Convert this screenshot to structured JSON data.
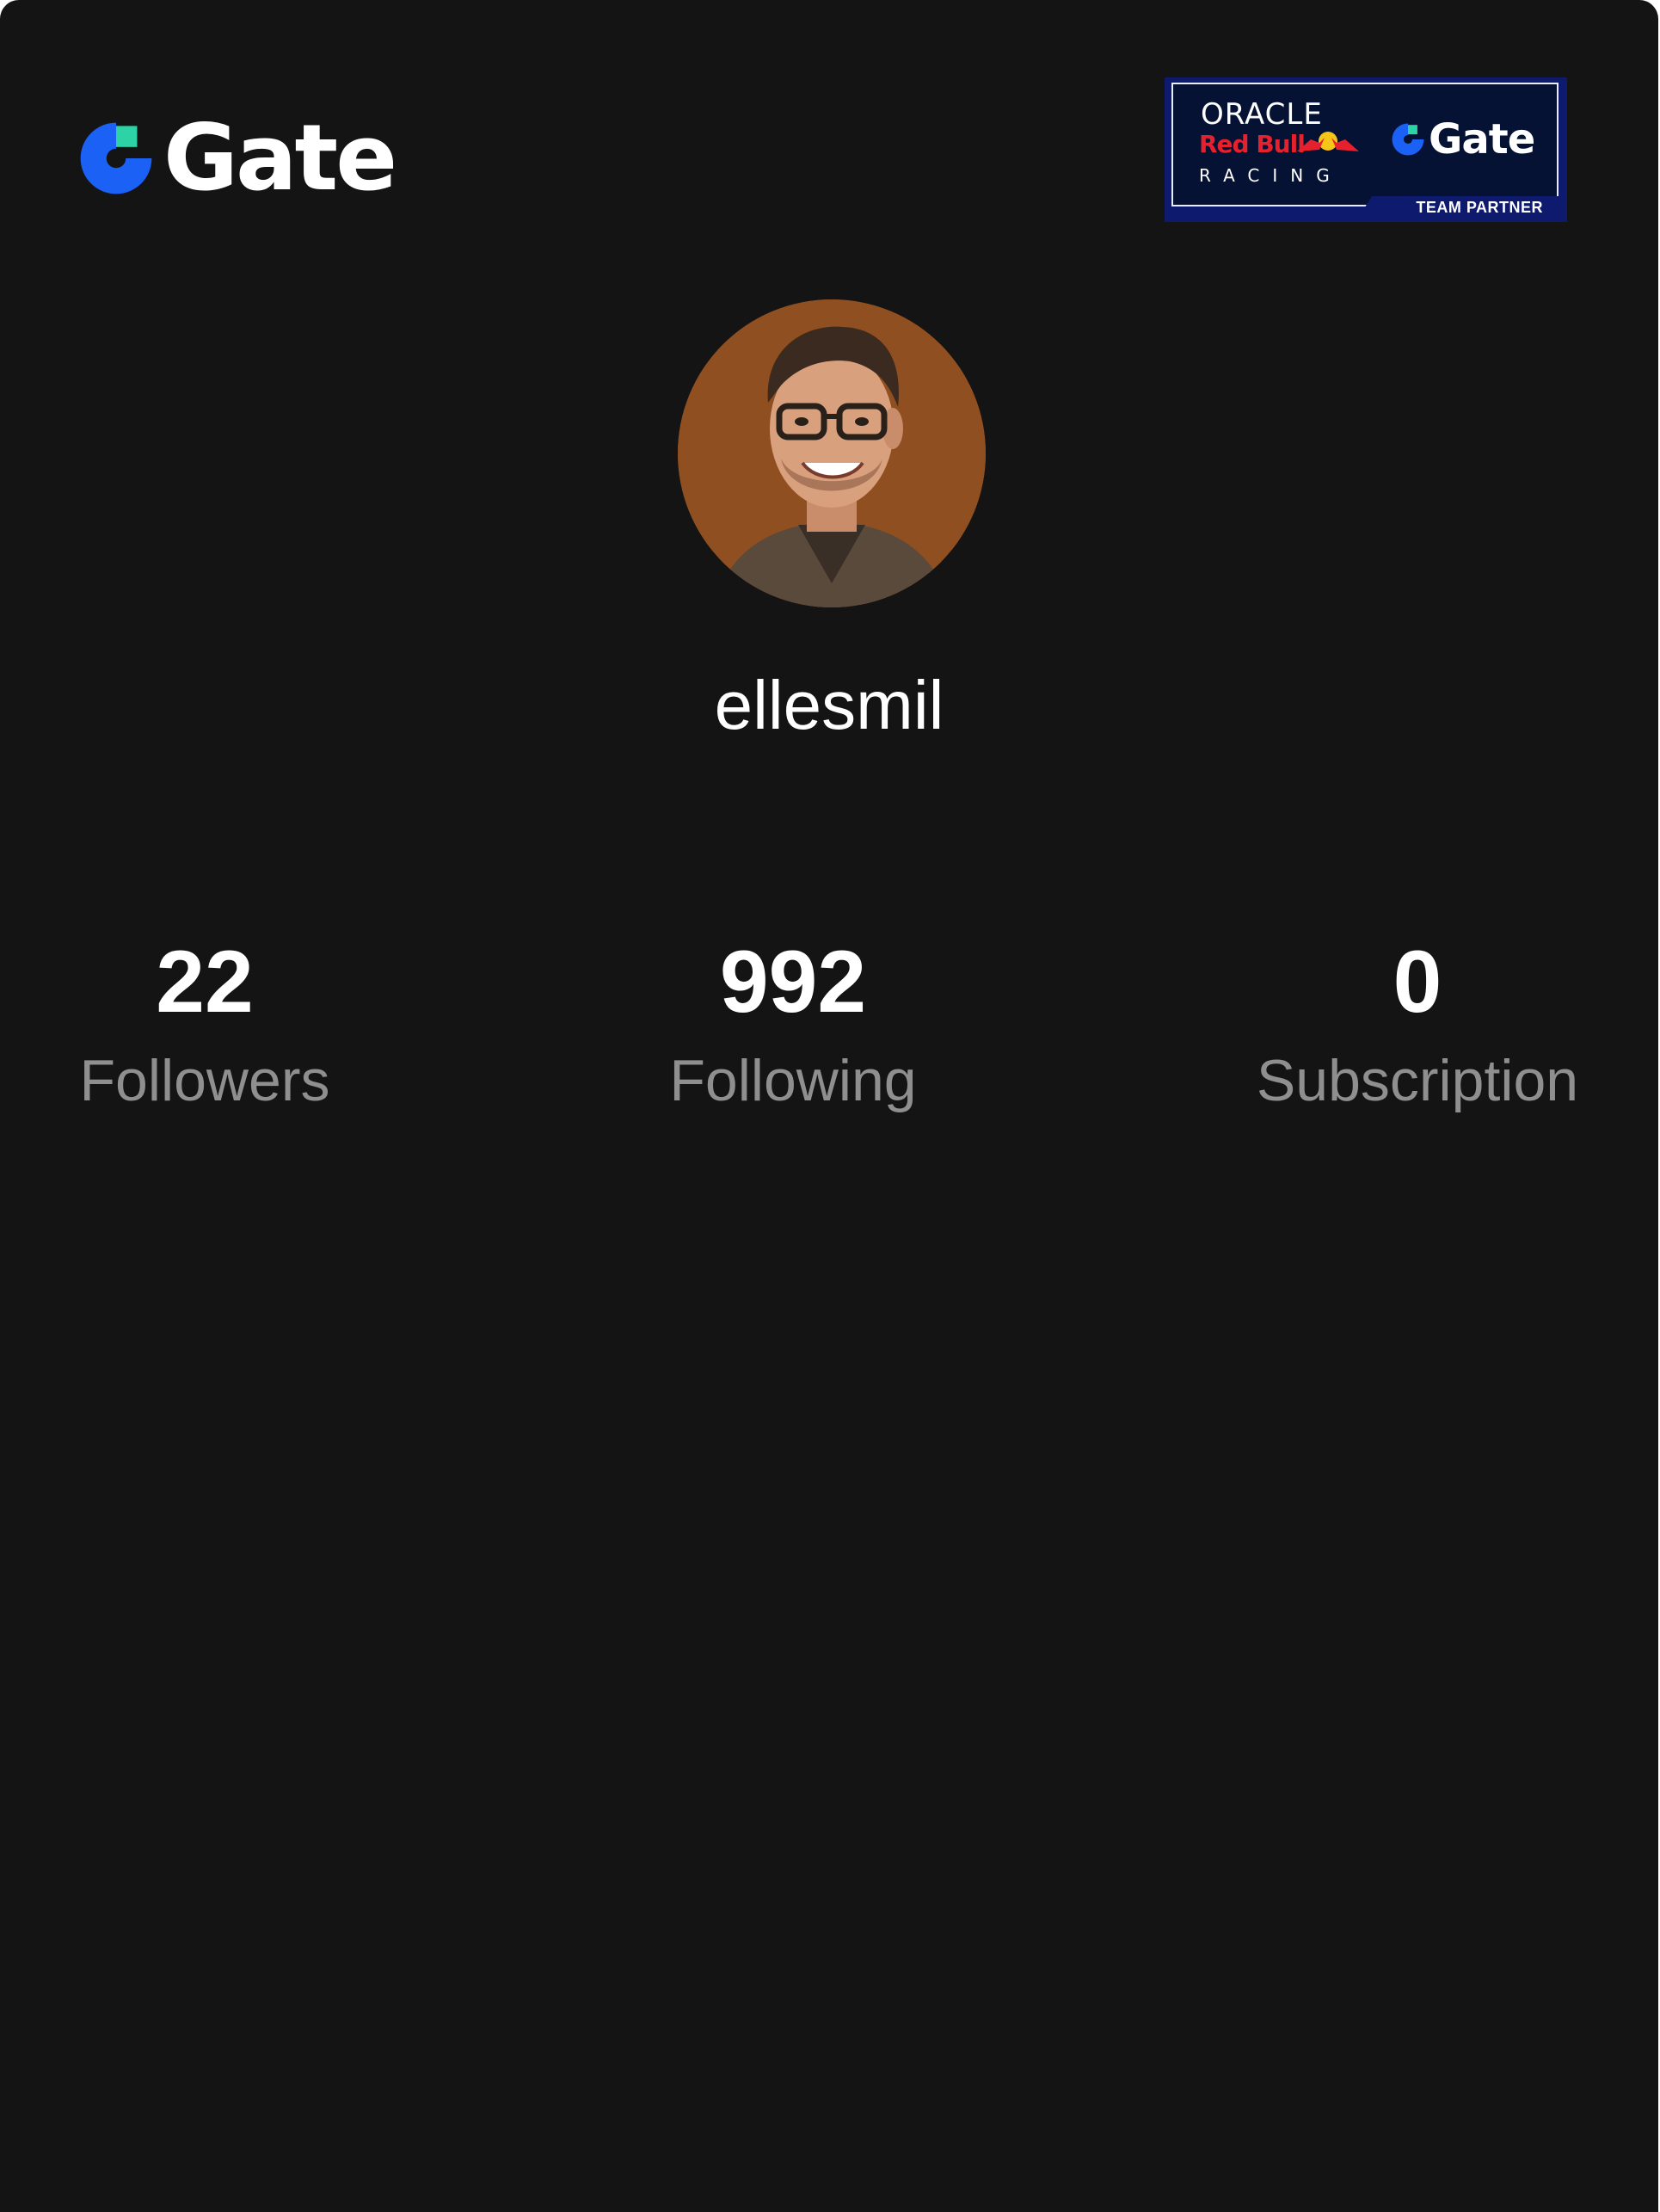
{
  "brand": {
    "logo_word": "Gate",
    "primary_color": "#1b61f5",
    "accent_color": "#2ed3a5"
  },
  "partner_badge": {
    "oracle": "ORACLE",
    "red_bull": "Red Bull",
    "racing": "RACING",
    "gate_word": "Gate",
    "team_partner": "TEAM PARTNER"
  },
  "profile": {
    "username": "ellesmil",
    "avatar_background": "#8f4f21"
  },
  "stats": [
    {
      "value": "22",
      "label": "Followers"
    },
    {
      "value": "992",
      "label": "Following"
    },
    {
      "value": "0",
      "label": "Subscription"
    }
  ]
}
